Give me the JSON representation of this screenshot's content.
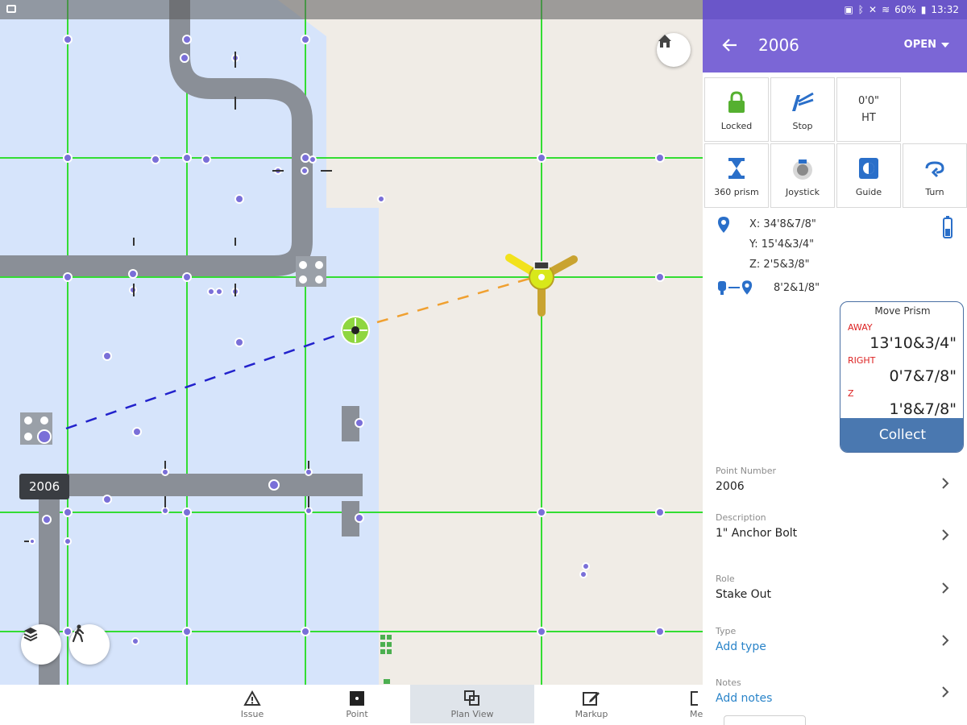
{
  "status_bar": {
    "icons": [
      "sim-icon",
      "bluetooth-icon",
      "mute-icon",
      "wifi-icon"
    ],
    "battery": "60%",
    "time": "13:32"
  },
  "header": {
    "title": "2006",
    "status_label": "OPEN"
  },
  "tools": [
    {
      "name": "locked",
      "label": "Locked",
      "icon": "lock-icon"
    },
    {
      "name": "stop",
      "label": "Stop",
      "icon": "stop-laser-icon"
    },
    {
      "name": "ht",
      "value": "0'0\"",
      "label": "HT"
    },
    {
      "name": "360-prism",
      "label": "360 prism",
      "icon": "prism-icon"
    },
    {
      "name": "joystick",
      "label": "Joystick",
      "icon": "joystick-icon"
    },
    {
      "name": "guide",
      "label": "Guide",
      "icon": "guide-icon"
    },
    {
      "name": "turn",
      "label": "Turn",
      "icon": "turn-icon"
    }
  ],
  "coordinates": {
    "x": "X: 34'8&7/8\"",
    "y": "Y: 15'4&3/4\"",
    "z": "Z: 2'5&3/8\"",
    "distance": "8'2&1/8\""
  },
  "move_prism": {
    "title": "Move Prism",
    "away_label": "AWAY",
    "away_value": "13'10&3/4\"",
    "right_label": "RIGHT",
    "right_value": "0'7&7/8\"",
    "z_label": "Z",
    "z_value": "1'8&7/8\"",
    "collect_label": "Collect"
  },
  "details": {
    "point_number": {
      "label": "Point Number",
      "value": "2006"
    },
    "description": {
      "label": "Description",
      "value": "1\" Anchor Bolt"
    },
    "role": {
      "label": "Role",
      "value": "Stake Out"
    },
    "type": {
      "label": "Type",
      "value": "Add type"
    },
    "notes": {
      "label": "Notes",
      "value": "Add notes"
    }
  },
  "map": {
    "selected_point_label": "2006"
  },
  "toolbar": [
    {
      "name": "issue",
      "label": "Issue"
    },
    {
      "name": "point",
      "label": "Point"
    },
    {
      "name": "plan-view",
      "label": "Plan View",
      "active": true
    },
    {
      "name": "markup",
      "label": "Markup"
    },
    {
      "name": "more",
      "label": "Me"
    }
  ],
  "colors": {
    "accent": "#7b66d6",
    "grid": "#33dd33",
    "collect": "#4a78b0",
    "direction": "#dd2222",
    "link": "#2a84c9"
  }
}
